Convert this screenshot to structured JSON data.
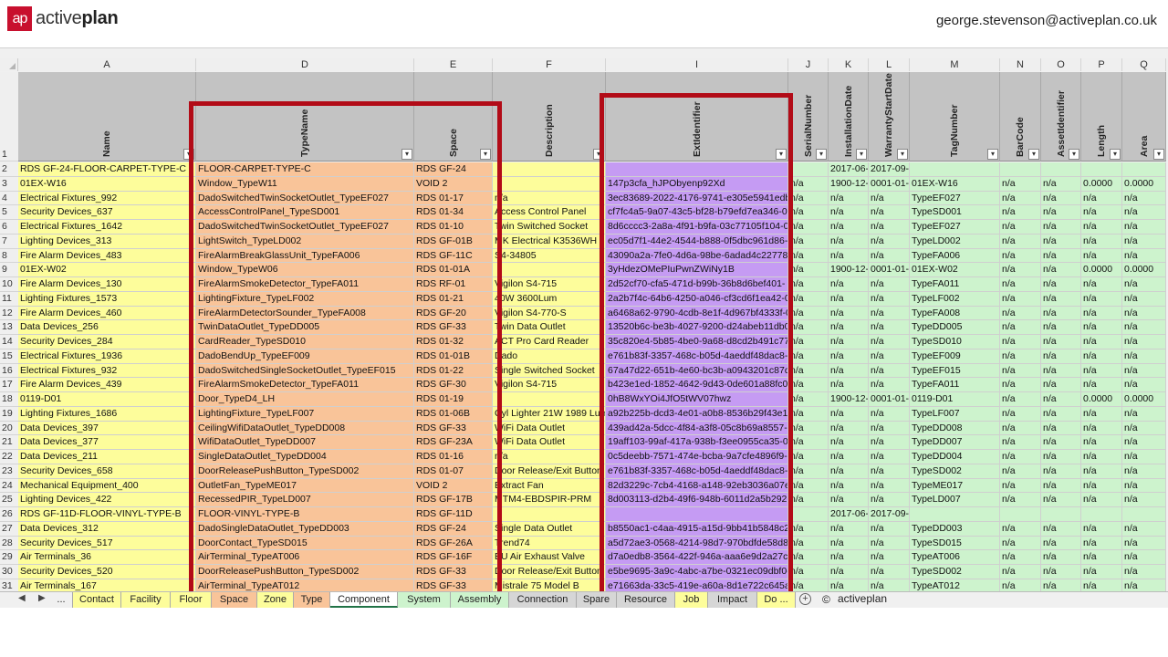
{
  "app": {
    "logo_mark": "ap",
    "logo_light": "active",
    "logo_bold": "plan",
    "user_email": "george.stevenson@activeplan.co.uk"
  },
  "columns": [
    {
      "letter": "A",
      "header": "Name",
      "color": "yellow"
    },
    {
      "letter": "D",
      "header": "TypeName",
      "color": "orange"
    },
    {
      "letter": "E",
      "header": "Space",
      "color": "orange"
    },
    {
      "letter": "F",
      "header": "Description",
      "color": "yellow"
    },
    {
      "letter": "I",
      "header": "ExtIdentifier",
      "color": "purple"
    },
    {
      "letter": "J",
      "header": "SerialNumber",
      "color": "green"
    },
    {
      "letter": "K",
      "header": "InstallationDate",
      "color": "green"
    },
    {
      "letter": "L",
      "header": "WarrantyStartDate",
      "color": "green"
    },
    {
      "letter": "M",
      "header": "TagNumber",
      "color": "green"
    },
    {
      "letter": "N",
      "header": "BarCode",
      "color": "green"
    },
    {
      "letter": "O",
      "header": "AssetIdentifier",
      "color": "green"
    },
    {
      "letter": "P",
      "header": "Length",
      "color": "green"
    },
    {
      "letter": "Q",
      "header": "Area",
      "color": "green"
    }
  ],
  "rows": [
    {
      "n": "2",
      "c": [
        "RDS GF-24-FLOOR-CARPET-TYPE-C",
        "FLOOR-CARPET-TYPE-C",
        "RDS GF-24",
        "",
        "",
        "",
        "2017-06-",
        "2017-09-",
        "",
        "",
        "",
        "",
        ""
      ]
    },
    {
      "n": "3",
      "c": [
        "01EX-W16",
        "Window_TypeW11",
        "VOID 2",
        "",
        "147p3cfa_hJPObyenp92Xd",
        "n/a",
        "1900-12-",
        "0001-01-",
        "01EX-W16",
        "n/a",
        "n/a",
        "0.0000",
        "0.0000"
      ]
    },
    {
      "n": "4",
      "c": [
        "Electrical Fixtures_992",
        "DadoSwitchedTwinSocketOutlet_TypeEF027",
        "RDS 01-17",
        "n/a",
        "3ec83689-2022-4176-9741-e305e5941edb",
        "n/a",
        "n/a",
        "n/a",
        "TypeEF027",
        "n/a",
        "n/a",
        "n/a",
        "n/a"
      ]
    },
    {
      "n": "5",
      "c": [
        "Security Devices_637",
        "AccessControlPanel_TypeSD001",
        "RDS 01-34",
        "Access Control Panel",
        "cf7fc4a5-9a07-43c5-bf28-b79efd7ea346-0",
        "n/a",
        "n/a",
        "n/a",
        "TypeSD001",
        "n/a",
        "n/a",
        "n/a",
        "n/a"
      ]
    },
    {
      "n": "6",
      "c": [
        "Electrical Fixtures_1642",
        "DadoSwitchedTwinSocketOutlet_TypeEF027",
        "RDS 01-10",
        "Twin Switched Socket",
        "8d6cccc3-2a8a-4f91-b9fa-03c77105f104-00",
        "n/a",
        "n/a",
        "n/a",
        "TypeEF027",
        "n/a",
        "n/a",
        "n/a",
        "n/a"
      ]
    },
    {
      "n": "7",
      "c": [
        "Lighting Devices_313",
        "LightSwitch_TypeLD002",
        "RDS GF-01B",
        "MK Electrical K3536WH",
        "ec05d7f1-44e2-4544-b888-0f5dbc961d86-",
        "n/a",
        "n/a",
        "n/a",
        "TypeLD002",
        "n/a",
        "n/a",
        "n/a",
        "n/a"
      ]
    },
    {
      "n": "8",
      "c": [
        "Fire Alarm Devices_483",
        "FireAlarmBreakGlassUnit_TypeFA006",
        "RDS GF-11C",
        "S4-34805",
        "43090a2a-7fe0-4d6a-98be-6adad4c22778-",
        "n/a",
        "n/a",
        "n/a",
        "TypeFA006",
        "n/a",
        "n/a",
        "n/a",
        "n/a"
      ]
    },
    {
      "n": "9",
      "c": [
        "01EX-W02",
        "Window_TypeW06",
        "RDS 01-01A",
        "",
        "3yHdezOMePIuPwnZWiNy1B",
        "n/a",
        "1900-12-",
        "0001-01-",
        "01EX-W02",
        "n/a",
        "n/a",
        "0.0000",
        "0.0000"
      ]
    },
    {
      "n": "10",
      "c": [
        "Fire Alarm Devices_130",
        "FireAlarmSmokeDetector_TypeFA011",
        "RDS RF-01",
        "Vigilon S4-715",
        "2d52cf70-cfa5-471d-b99b-36b8d6bef401-",
        "n/a",
        "n/a",
        "n/a",
        "TypeFA011",
        "n/a",
        "n/a",
        "n/a",
        "n/a"
      ]
    },
    {
      "n": "11",
      "c": [
        "Lighting Fixtures_1573",
        "LightingFixture_TypeLF002",
        "RDS 01-21",
        "40W 3600Lum",
        "2a2b7f4c-64b6-4250-a046-cf3cd6f1ea42-0",
        "n/a",
        "n/a",
        "n/a",
        "TypeLF002",
        "n/a",
        "n/a",
        "n/a",
        "n/a"
      ]
    },
    {
      "n": "12",
      "c": [
        "Fire Alarm Devices_460",
        "FireAlarmDetectorSounder_TypeFA008",
        "RDS GF-20",
        "Vigilon S4-770-S",
        "a6468a62-9790-4cdb-8e1f-4d967bf4333f-0",
        "n/a",
        "n/a",
        "n/a",
        "TypeFA008",
        "n/a",
        "n/a",
        "n/a",
        "n/a"
      ]
    },
    {
      "n": "13",
      "c": [
        "Data Devices_256",
        "TwinDataOutlet_TypeDD005",
        "RDS GF-33",
        "Twin Data Outlet",
        "13520b6c-be3b-4027-9200-d24abeb11db0",
        "n/a",
        "n/a",
        "n/a",
        "TypeDD005",
        "n/a",
        "n/a",
        "n/a",
        "n/a"
      ]
    },
    {
      "n": "14",
      "c": [
        "Security Devices_284",
        "CardReader_TypeSD010",
        "RDS 01-32",
        "ACT Pro Card Reader",
        "35c820e4-5b85-4be0-9a68-d8cd2b491c77-",
        "n/a",
        "n/a",
        "n/a",
        "TypeSD010",
        "n/a",
        "n/a",
        "n/a",
        "n/a"
      ]
    },
    {
      "n": "15",
      "c": [
        "Electrical Fixtures_1936",
        "DadoBendUp_TypeEF009",
        "RDS 01-01B",
        "Dado",
        "e761b83f-3357-468c-b05d-4aeddf48dac8-",
        "n/a",
        "n/a",
        "n/a",
        "TypeEF009",
        "n/a",
        "n/a",
        "n/a",
        "n/a"
      ]
    },
    {
      "n": "16",
      "c": [
        "Electrical Fixtures_932",
        "DadoSwitchedSingleSocketOutlet_TypeEF015",
        "RDS 01-22",
        "Single Switched Socket",
        "67a47d22-651b-4e60-bc3b-a0943201c87d-",
        "n/a",
        "n/a",
        "n/a",
        "TypeEF015",
        "n/a",
        "n/a",
        "n/a",
        "n/a"
      ]
    },
    {
      "n": "17",
      "c": [
        "Fire Alarm Devices_439",
        "FireAlarmSmokeDetector_TypeFA011",
        "RDS GF-30",
        "Vigilon S4-715",
        "b423e1ed-1852-4642-9d43-0de601a88fc0-",
        "n/a",
        "n/a",
        "n/a",
        "TypeFA011",
        "n/a",
        "n/a",
        "n/a",
        "n/a"
      ]
    },
    {
      "n": "18",
      "c": [
        "0119-D01",
        "Door_TypeD4_LH",
        "RDS 01-19",
        "",
        "0hB8WxYOi4JfO5tWV07hwz",
        "n/a",
        "1900-12-",
        "0001-01-",
        "0119-D01",
        "n/a",
        "n/a",
        "0.0000",
        "0.0000"
      ]
    },
    {
      "n": "19",
      "c": [
        "Lighting Fixtures_1686",
        "LightingFixture_TypeLF007",
        "RDS 01-06B",
        "Cyl Lighter 21W 1989 Lum",
        "a92b225b-dcd3-4e01-a0b8-8536b29f43e1",
        "n/a",
        "n/a",
        "n/a",
        "TypeLF007",
        "n/a",
        "n/a",
        "n/a",
        "n/a"
      ]
    },
    {
      "n": "20",
      "c": [
        "Data Devices_397",
        "CeilingWifiDataOutlet_TypeDD008",
        "RDS GF-33",
        "WiFi Data Outlet",
        "439ad42a-5dcc-4f84-a3f8-05c8b69a8557-0",
        "n/a",
        "n/a",
        "n/a",
        "TypeDD008",
        "n/a",
        "n/a",
        "n/a",
        "n/a"
      ]
    },
    {
      "n": "21",
      "c": [
        "Data Devices_377",
        "WifiDataOutlet_TypeDD007",
        "RDS GF-23A",
        "WiFi Data Outlet",
        "19aff103-99af-417a-938b-f3ee0955ca35-0",
        "n/a",
        "n/a",
        "n/a",
        "TypeDD007",
        "n/a",
        "n/a",
        "n/a",
        "n/a"
      ]
    },
    {
      "n": "22",
      "c": [
        "Data Devices_211",
        "SingleDataOutlet_TypeDD004",
        "RDS 01-16",
        "n/a",
        "0c5deebb-7571-474e-bcba-9a7cfe4896f9-",
        "n/a",
        "n/a",
        "n/a",
        "TypeDD004",
        "n/a",
        "n/a",
        "n/a",
        "n/a"
      ]
    },
    {
      "n": "23",
      "c": [
        "Security Devices_658",
        "DoorReleasePushButton_TypeSD002",
        "RDS 01-07",
        "Door Release/Exit Button",
        "e761b83f-3357-468c-b05d-4aeddf48dac8-",
        "n/a",
        "n/a",
        "n/a",
        "TypeSD002",
        "n/a",
        "n/a",
        "n/a",
        "n/a"
      ]
    },
    {
      "n": "24",
      "c": [
        "Mechanical Equipment_400",
        "OutletFan_TypeME017",
        "VOID 2",
        "Extract Fan",
        "82d3229c-7cb4-4168-a148-92eb3036a07e-",
        "n/a",
        "n/a",
        "n/a",
        "TypeME017",
        "n/a",
        "n/a",
        "n/a",
        "n/a"
      ]
    },
    {
      "n": "25",
      "c": [
        "Lighting Devices_422",
        "RecessedPIR_TypeLD007",
        "RDS GF-17B",
        "MTM4-EBDSPIR-PRM",
        "8d003113-d2b4-49f6-948b-6011d2a5b292-",
        "n/a",
        "n/a",
        "n/a",
        "TypeLD007",
        "n/a",
        "n/a",
        "n/a",
        "n/a"
      ]
    },
    {
      "n": "26",
      "c": [
        "RDS GF-11D-FLOOR-VINYL-TYPE-B",
        "FLOOR-VINYL-TYPE-B",
        "RDS GF-11D",
        "",
        "",
        "",
        "2017-06-",
        "2017-09-",
        "",
        "",
        "",
        "",
        ""
      ]
    },
    {
      "n": "27",
      "c": [
        "Data Devices_312",
        "DadoSingleDataOutlet_TypeDD003",
        "RDS GF-24",
        "Single Data Outlet",
        "b8550ac1-c4aa-4915-a15d-9bb41b5848c2-",
        "n/a",
        "n/a",
        "n/a",
        "TypeDD003",
        "n/a",
        "n/a",
        "n/a",
        "n/a"
      ]
    },
    {
      "n": "28",
      "c": [
        "Security Devices_517",
        "DoorContact_TypeSD015",
        "RDS GF-26A",
        "Trend74",
        "a5d72ae3-0568-4214-98d7-970bdfde58d8-",
        "n/a",
        "n/a",
        "n/a",
        "TypeSD015",
        "n/a",
        "n/a",
        "n/a",
        "n/a"
      ]
    },
    {
      "n": "29",
      "c": [
        "Air Terminals_36",
        "AirTerminal_TypeAT006",
        "RDS GF-16F",
        "EU Air Exhaust Valve",
        "d7a0edb8-3564-422f-946a-aaa6e9d2a27c-",
        "n/a",
        "n/a",
        "n/a",
        "TypeAT006",
        "n/a",
        "n/a",
        "n/a",
        "n/a"
      ]
    },
    {
      "n": "30",
      "c": [
        "Security Devices_520",
        "DoorReleasePushButton_TypeSD002",
        "RDS GF-33",
        "Door Release/Exit Button",
        "e5be9695-3a9c-4abc-a7be-0321ec09dbf0-",
        "n/a",
        "n/a",
        "n/a",
        "TypeSD002",
        "n/a",
        "n/a",
        "n/a",
        "n/a"
      ]
    },
    {
      "n": "31",
      "c": [
        "Air Terminals_167",
        "AirTerminal_TypeAT012",
        "RDS GF-33",
        "Mistrale 75 Model B",
        "e71663da-33c5-419e-a60a-8d1e722c645a-",
        "n/a",
        "n/a",
        "n/a",
        "TypeAT012",
        "n/a",
        "n/a",
        "n/a",
        "n/a"
      ]
    }
  ],
  "tabs": [
    {
      "label": "...",
      "color": "#f0f0f0"
    },
    {
      "label": "Contact",
      "color": "#fdfd9b"
    },
    {
      "label": "Facility",
      "color": "#fdfd9b"
    },
    {
      "label": "Floor",
      "color": "#fdfd9b"
    },
    {
      "label": "Space",
      "color": "#f9c499"
    },
    {
      "label": "Zone",
      "color": "#fdfd9b"
    },
    {
      "label": "Type",
      "color": "#f9c499"
    },
    {
      "label": "Component",
      "color": "#ffffff",
      "selected": true
    },
    {
      "label": "System",
      "color": "#cdf3cd"
    },
    {
      "label": "Assembly",
      "color": "#cdf3cd"
    },
    {
      "label": "Connection",
      "color": "#d6d6d6"
    },
    {
      "label": "Spare",
      "color": "#d6d6d6"
    },
    {
      "label": "Resource",
      "color": "#d6d6d6"
    },
    {
      "label": "Job",
      "color": "#fdfd9b"
    },
    {
      "label": "Impact",
      "color": "#d6d6d6"
    },
    {
      "label": "Do ...",
      "color": "#fdfd9b"
    }
  ],
  "footer": {
    "brand": "activeplan",
    "copyright": "©"
  }
}
